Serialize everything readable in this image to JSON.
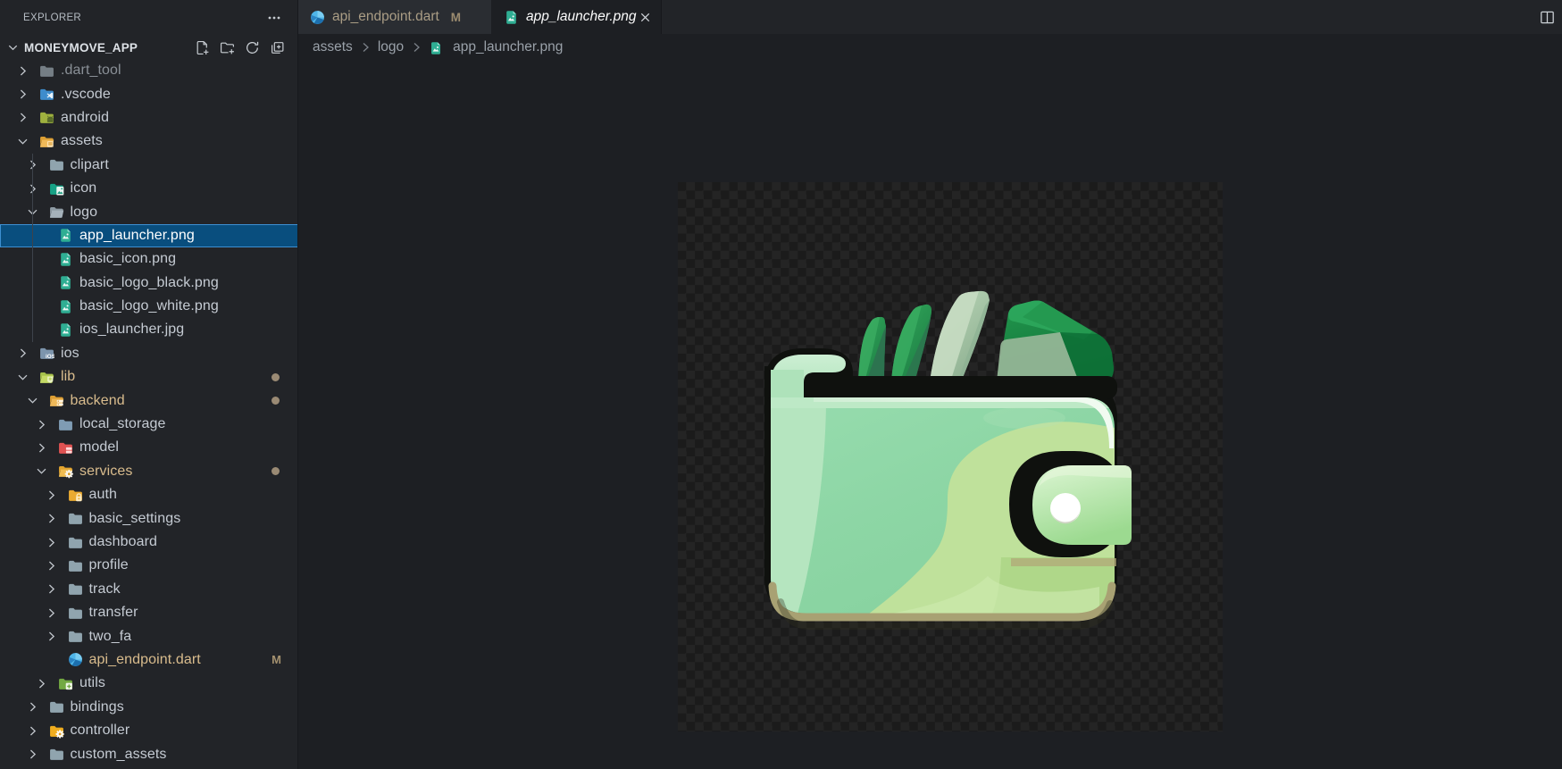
{
  "sidebar": {
    "title": "EXPLORER",
    "project": "MONEYMOVE_APP",
    "header_icons": [
      "more-actions",
      "new-file",
      "new-folder",
      "refresh-explorer",
      "collapse-folders"
    ],
    "tree": [
      {
        "label": ".dart_tool",
        "level": 1,
        "icon": "folder-dim",
        "chev": "right",
        "state": "dim"
      },
      {
        "label": ".vscode",
        "level": 1,
        "icon": "folder-vscode",
        "chev": "right",
        "state": "normal"
      },
      {
        "label": "android",
        "level": 1,
        "icon": "folder-android",
        "chev": "right",
        "state": "normal"
      },
      {
        "label": "assets",
        "level": 1,
        "icon": "folder-assets-open",
        "chev": "down",
        "state": "normal"
      },
      {
        "label": "clipart",
        "level": 2,
        "icon": "folder",
        "chev": "right",
        "state": "normal"
      },
      {
        "label": "icon",
        "level": 2,
        "icon": "folder-images",
        "chev": "right",
        "state": "normal"
      },
      {
        "label": "logo",
        "level": 2,
        "icon": "folder-open",
        "chev": "down",
        "state": "normal"
      },
      {
        "label": "app_launcher.png",
        "level": 3,
        "icon": "file-image",
        "chev": "none",
        "state": "selected"
      },
      {
        "label": "basic_icon.png",
        "level": 3,
        "icon": "file-image",
        "chev": "none",
        "state": "normal"
      },
      {
        "label": "basic_logo_black.png",
        "level": 3,
        "icon": "file-image",
        "chev": "none",
        "state": "normal"
      },
      {
        "label": "basic_logo_white.png",
        "level": 3,
        "icon": "file-image",
        "chev": "none",
        "state": "normal"
      },
      {
        "label": "ios_launcher.jpg",
        "level": 3,
        "icon": "file-image",
        "chev": "none",
        "state": "normal"
      },
      {
        "label": "ios",
        "level": 1,
        "icon": "folder-ios",
        "chev": "right",
        "state": "normal"
      },
      {
        "label": "lib",
        "level": 1,
        "icon": "folder-lib-open",
        "chev": "down",
        "state": "modified",
        "badge": "dot"
      },
      {
        "label": "backend",
        "level": 2,
        "icon": "folder-backend-open",
        "chev": "down",
        "state": "modified",
        "badge": "dot"
      },
      {
        "label": "local_storage",
        "level": 3,
        "icon": "folder-storage",
        "chev": "right",
        "state": "normal"
      },
      {
        "label": "model",
        "level": 3,
        "icon": "folder-model",
        "chev": "right",
        "state": "normal"
      },
      {
        "label": "services",
        "level": 3,
        "icon": "folder-services-open",
        "chev": "down",
        "state": "modified",
        "badge": "dot"
      },
      {
        "label": "auth",
        "level": 4,
        "icon": "folder-auth",
        "chev": "right",
        "state": "normal"
      },
      {
        "label": "basic_settings",
        "level": 4,
        "icon": "folder",
        "chev": "right",
        "state": "normal"
      },
      {
        "label": "dashboard",
        "level": 4,
        "icon": "folder",
        "chev": "right",
        "state": "normal"
      },
      {
        "label": "profile",
        "level": 4,
        "icon": "folder",
        "chev": "right",
        "state": "normal"
      },
      {
        "label": "track",
        "level": 4,
        "icon": "folder",
        "chev": "right",
        "state": "normal"
      },
      {
        "label": "transfer",
        "level": 4,
        "icon": "folder",
        "chev": "right",
        "state": "normal"
      },
      {
        "label": "two_fa",
        "level": 4,
        "icon": "folder",
        "chev": "right",
        "state": "normal"
      },
      {
        "label": "api_endpoint.dart",
        "level": 4,
        "icon": "file-dart",
        "chev": "none",
        "state": "modified",
        "badge": "M"
      },
      {
        "label": "utils",
        "level": 3,
        "icon": "folder-utils",
        "chev": "right",
        "state": "normal"
      },
      {
        "label": "bindings",
        "level": 2,
        "icon": "folder",
        "chev": "right",
        "state": "normal"
      },
      {
        "label": "controller",
        "level": 2,
        "icon": "folder-controller",
        "chev": "right",
        "state": "normal"
      },
      {
        "label": "custom_assets",
        "level": 2,
        "icon": "folder",
        "chev": "right",
        "state": "normal"
      }
    ]
  },
  "tabs": [
    {
      "label": "api_endpoint.dart",
      "icon": "dart-file-icon",
      "badge": "M",
      "active": false,
      "modified": true
    },
    {
      "label": "app_launcher.png",
      "icon": "image-file-icon",
      "close": "×",
      "active": true,
      "preview": true
    }
  ],
  "breadcrumb": {
    "items": [
      "assets",
      "logo",
      "app_launcher.png"
    ],
    "separator": "›"
  },
  "image_preview": {
    "description": "app launcher logo: light green wallet with green banknotes sticking out and a clasp with white snap button, on transparent checkerboard",
    "zoom": "1:1"
  },
  "colors": {
    "sidebar_bg": "#22262b",
    "editor_bg": "#1e2126",
    "tab_inactive_bg": "#2b2e34",
    "selection_bg": "#094e7e",
    "selection_border": "#3d8fd1",
    "modified_text": "#d9bc8d",
    "tree_text": "#c5cbd3",
    "wallet_body": "#b7e5bf",
    "wallet_inner": "#92d8a8",
    "wallet_accent": "#c3e7a3",
    "bill_green": "#1d8a44",
    "folder_default": "#90a4ae",
    "image_file_teal": "#2fae93"
  }
}
